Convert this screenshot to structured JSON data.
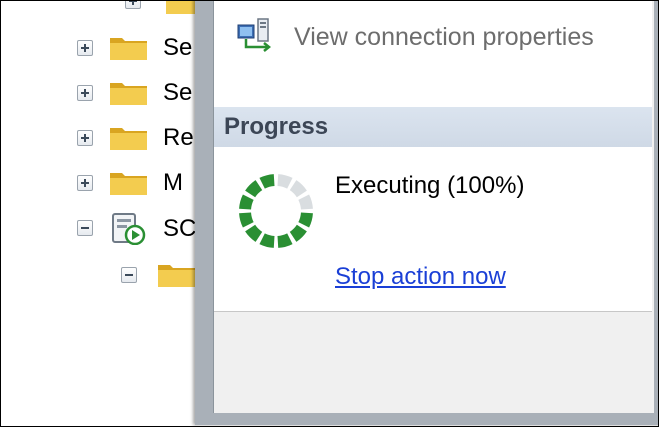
{
  "tree": {
    "nodes": [
      {
        "label": "",
        "state": "expand"
      },
      {
        "label": "Se",
        "state": "expand"
      },
      {
        "label": "Se",
        "state": "expand"
      },
      {
        "label": "Re",
        "state": "expand"
      },
      {
        "label": "M",
        "state": "expand"
      },
      {
        "label": "SC",
        "state": "collapse"
      },
      {
        "label": "",
        "state": "collapse"
      }
    ]
  },
  "dialog": {
    "connection_link": "View connection properties",
    "section_title": "Progress",
    "status_text": "Executing (100%)",
    "stop_link": "Stop action now"
  },
  "colors": {
    "spinner_green": "#2a8f33",
    "spinner_light": "#d9dde0",
    "link_blue": "#1a3fd6",
    "header_bg": "#d3dde9"
  }
}
